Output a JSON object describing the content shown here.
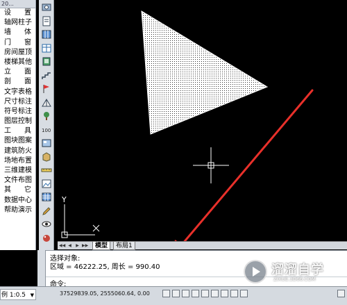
{
  "menu": {
    "title": "20...",
    "items": [
      {
        "label": "设　置",
        "spread": true
      },
      {
        "label": "轴网柱子",
        "spread": false
      },
      {
        "label": "墙　体",
        "spread": true
      },
      {
        "label": "门　窗",
        "spread": true
      },
      {
        "label": "房间屋顶",
        "spread": false
      },
      {
        "label": "楼梯其他",
        "spread": false
      },
      {
        "label": "立　面",
        "spread": true
      },
      {
        "label": "剖　面",
        "spread": true
      },
      {
        "label": "文字表格",
        "spread": false
      },
      {
        "label": "尺寸标注",
        "spread": false
      },
      {
        "label": "符号标注",
        "spread": false
      },
      {
        "label": "图层控制",
        "spread": false
      },
      {
        "label": "工　具",
        "spread": true
      },
      {
        "label": "图块图案",
        "spread": false
      },
      {
        "label": "建筑防火",
        "spread": false
      },
      {
        "label": "场地布置",
        "spread": false
      },
      {
        "label": "三维建模",
        "spread": false
      },
      {
        "label": "文件布图",
        "spread": false
      },
      {
        "label": "其　它",
        "spread": true
      },
      {
        "label": "数据中心",
        "spread": false
      },
      {
        "label": "帮助演示",
        "spread": false
      }
    ]
  },
  "toolbar": {
    "icons": [
      "camera-icon",
      "document-icon",
      "column-grid-icon",
      "table-icon",
      "window-icon",
      "stair-icon",
      "flag-icon",
      "elevation-icon",
      "tree-icon",
      "number-icon",
      "block-icon",
      "box-icon",
      "ruler-icon",
      "image-icon",
      "grid-icon",
      "pencil-icon",
      "eye-icon",
      "palette-icon"
    ],
    "number_label": "100"
  },
  "tabs": {
    "model_label": "模型",
    "layout1_label": "布局1"
  },
  "ucs": {
    "x_label": "X",
    "y_label": "Y"
  },
  "command": {
    "line1": "选择对象:",
    "line2": "区域 = 46222.25, 周长 = 990.40",
    "prompt": "命令:",
    "input_value": ""
  },
  "status": {
    "scale": "例 1:0.5",
    "coords": "37529839.05, 2555060.64, 0.00"
  },
  "watermark": {
    "title": "溜溜自学",
    "url": "ZIXUE.3D66.COM"
  },
  "colors": {
    "arrow": "#e8302a",
    "triangle_fill": "#ffffff",
    "canvas_bg": "#000000"
  }
}
